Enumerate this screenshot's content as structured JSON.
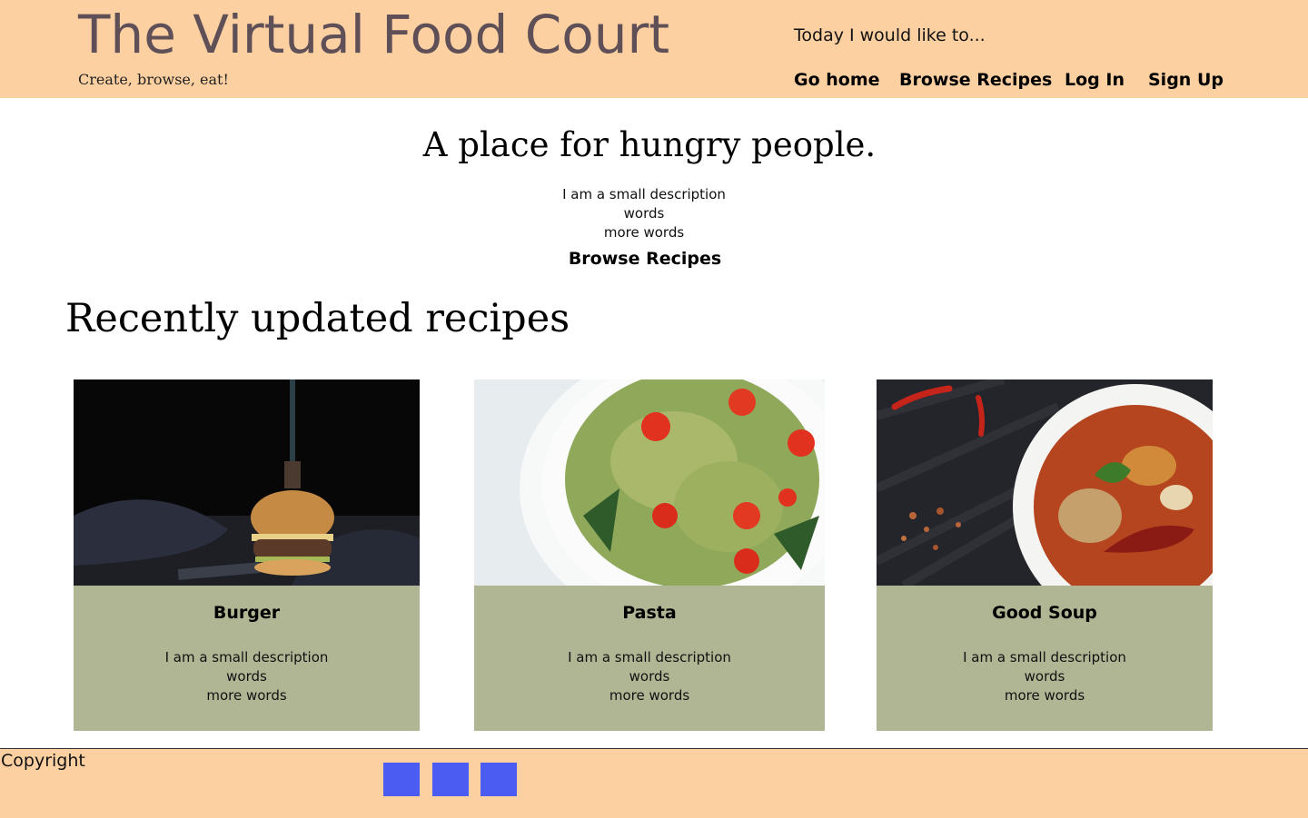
{
  "header": {
    "site_title": "The Virtual Food Court",
    "tagline": "Create, browse, eat!",
    "today_prompt": "Today I would like to...",
    "nav": [
      "Go home",
      "Browse Recipes",
      "Log In",
      "Sign Up"
    ]
  },
  "hero": {
    "title": "A place for hungry people.",
    "description": [
      "I am a small description",
      "words",
      "more words"
    ],
    "link": "Browse Recipes"
  },
  "recent": {
    "title": "Recently updated recipes",
    "cards": [
      {
        "title": "Burger",
        "description": [
          "I am a small description",
          "words",
          "more words"
        ],
        "image": "burger-photo"
      },
      {
        "title": "Pasta",
        "description": [
          "I am a small description",
          "words",
          "more words"
        ],
        "image": "pasta-salad-photo"
      },
      {
        "title": "Good Soup",
        "description": [
          "I am a small description",
          "words",
          "more words"
        ],
        "image": "soup-bowl-photo"
      }
    ]
  },
  "footer": {
    "copyright": "Copyright",
    "social_icons": [
      "social-link-icon",
      "social-link-icon",
      "social-link-icon"
    ]
  },
  "colors": {
    "header_bg": "#fdd0a2",
    "title_color": "#5f4f57",
    "card_bg": "#b0b693",
    "social_icon": "#4b5cf3"
  }
}
